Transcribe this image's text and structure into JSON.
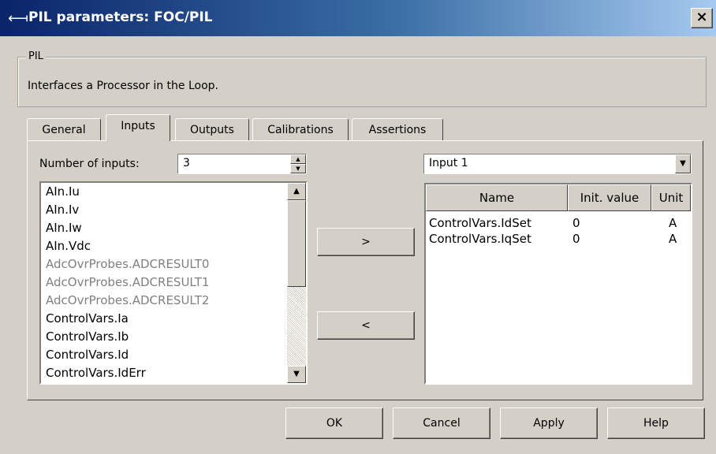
{
  "window": {
    "title": "PIL parameters: FOC/PIL",
    "close_symbol": "×"
  },
  "group": {
    "legend": "PIL",
    "description": "Interfaces a Processor in the Loop."
  },
  "tabs": [
    {
      "label": "General"
    },
    {
      "label": "Inputs",
      "active": true
    },
    {
      "label": "Outputs"
    },
    {
      "label": "Calibrations"
    },
    {
      "label": "Assertions"
    }
  ],
  "inputs_panel": {
    "num_inputs_label": "Number of inputs:",
    "num_inputs_value": "3",
    "available_signals": [
      {
        "label": "AIn.Iu",
        "enabled": true
      },
      {
        "label": "AIn.Iv",
        "enabled": true
      },
      {
        "label": "AIn.Iw",
        "enabled": true
      },
      {
        "label": "AIn.Vdc",
        "enabled": true
      },
      {
        "label": "AdcOvrProbes.ADCRESULT0",
        "enabled": false
      },
      {
        "label": "AdcOvrProbes.ADCRESULT1",
        "enabled": false
      },
      {
        "label": "AdcOvrProbes.ADCRESULT2",
        "enabled": false
      },
      {
        "label": "ControlVars.Ia",
        "enabled": true
      },
      {
        "label": "ControlVars.Ib",
        "enabled": true
      },
      {
        "label": "ControlVars.Id",
        "enabled": true
      },
      {
        "label": "ControlVars.IdErr",
        "enabled": true
      }
    ],
    "add_button": ">",
    "remove_button": "<",
    "input_selector_value": "Input 1",
    "table": {
      "headers": {
        "name": "Name",
        "init": "Init. value",
        "unit": "Unit"
      },
      "rows": [
        {
          "name": "ControlVars.IdSet",
          "init": "0",
          "unit": "A"
        },
        {
          "name": "ControlVars.IqSet",
          "init": "0",
          "unit": "A"
        }
      ]
    }
  },
  "buttons": {
    "ok": "OK",
    "cancel": "Cancel",
    "apply": "Apply",
    "help": "Help"
  }
}
